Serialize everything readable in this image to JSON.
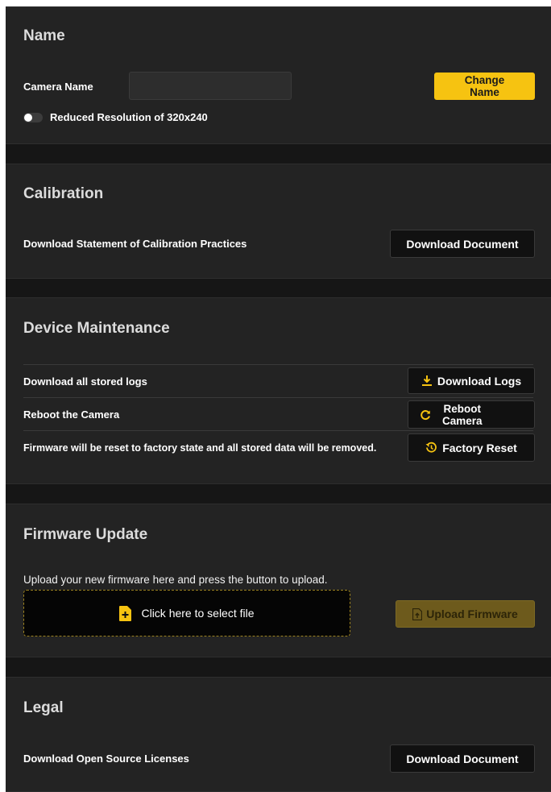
{
  "name_section": {
    "title": "Name",
    "camera_name_label": "Camera Name",
    "camera_name_value": "",
    "change_name_line1": "Change",
    "change_name_line2": "Name",
    "reduced_resolution_label": "Reduced Resolution of 320x240",
    "reduced_resolution_enabled": false
  },
  "calibration": {
    "title": "Calibration",
    "description": "Download Statement of Calibration Practices",
    "button_label": "Download Document"
  },
  "device_maintenance": {
    "title": "Device Maintenance",
    "rows": [
      {
        "label": "Download all stored logs",
        "button": "Download Logs",
        "icon": "download-icon"
      },
      {
        "label": "Reboot the Camera",
        "button_line1": "Reboot",
        "button_line2": "Camera",
        "icon": "refresh-icon"
      },
      {
        "label": "Firmware will be reset to factory state and all stored data will be removed.",
        "button": "Factory Reset",
        "icon": "history-icon"
      }
    ]
  },
  "firmware_update": {
    "title": "Firmware Update",
    "instructions": "Upload your new firmware here and press the button to upload.",
    "dropzone_label": "Click here to select file",
    "upload_button": "Upload Firmware"
  },
  "legal": {
    "title": "Legal",
    "description": "Download Open Source Licenses",
    "button_label": "Download Document"
  },
  "colors": {
    "accent": "#f6c311",
    "background": "#161616",
    "section_background": "#232323",
    "button_background": "#111111",
    "disabled_button": "#6d5a1c"
  }
}
